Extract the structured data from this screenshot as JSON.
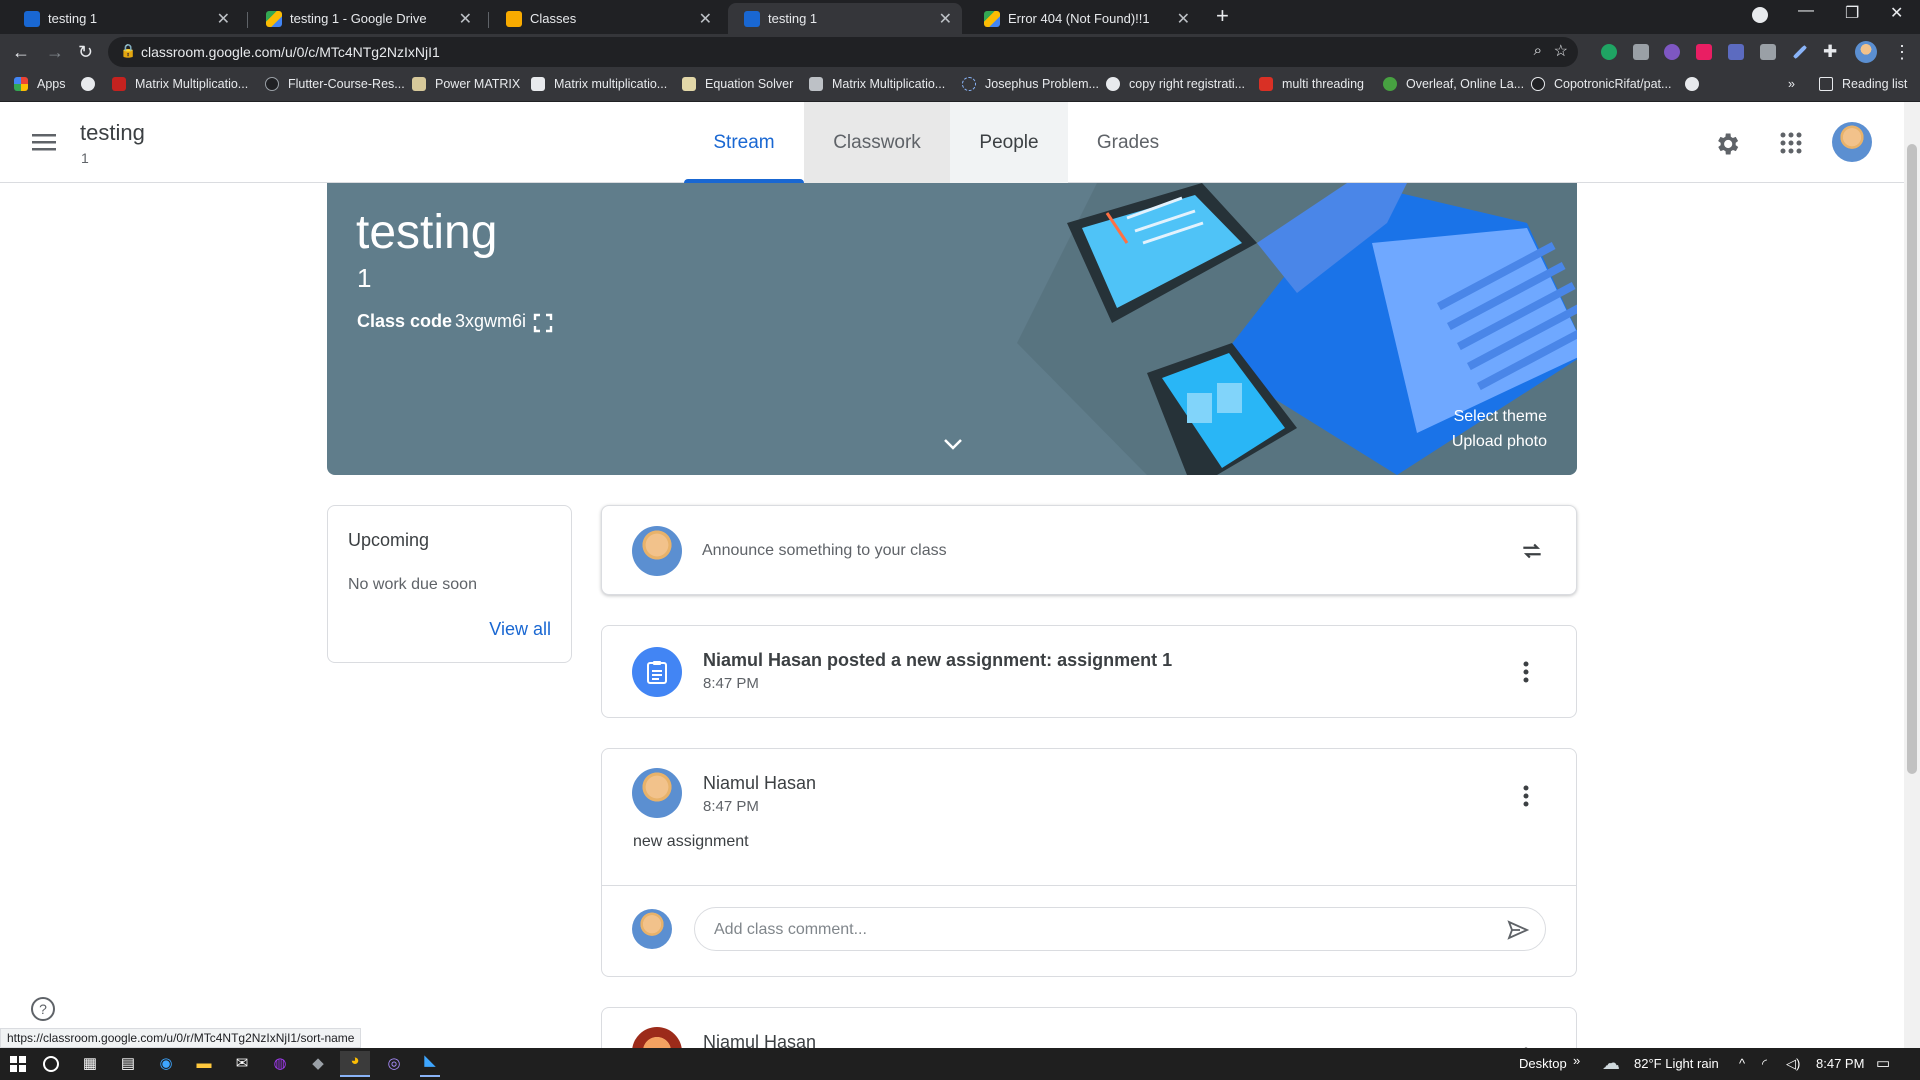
{
  "browser": {
    "tabs": [
      {
        "title": "testing 1",
        "favicon_color": "#1967d2"
      },
      {
        "title": "testing 1 - Google Drive",
        "favicon_color": "#fbbc04"
      },
      {
        "title": "Classes",
        "favicon_color": "#f9ab00"
      },
      {
        "title": "testing 1",
        "favicon_color": "#1967d2"
      },
      {
        "title": "Error 404 (Not Found)!!1",
        "favicon_color": "#34a853"
      }
    ],
    "url": "classroom.google.com/u/0/c/MTc4NTg2NzIxNjI1",
    "bookmarks": [
      "Apps",
      "Matrix Multiplicatio...",
      "Flutter-Course-Res...",
      "Power MATRIX",
      "Matrix multiplicatio...",
      "Equation Solver",
      "Matrix Multiplicatio...",
      "Josephus Problem...",
      "copy right registrati...",
      "multi threading",
      "Overleaf, Online La...",
      "CopotronicRifat/pat..."
    ],
    "reading_list": "Reading list",
    "status_url": "https://classroom.google.com/u/0/r/MTc4NTg2NzIxNjI1/sort-name"
  },
  "header": {
    "course_name": "testing",
    "course_section": "1",
    "tabs": [
      "Stream",
      "Classwork",
      "People",
      "Grades"
    ],
    "active_tab": "Stream"
  },
  "banner": {
    "title": "testing",
    "section": "1",
    "class_code_label": "Class code",
    "class_code": "3xgwm6i",
    "select_theme": "Select theme",
    "upload_photo": "Upload photo",
    "color": "#607d8b"
  },
  "upcoming": {
    "title": "Upcoming",
    "empty": "No work due soon",
    "view_all": "View all"
  },
  "announce": {
    "placeholder": "Announce something to your class"
  },
  "posts": [
    {
      "text": "Niamul Hasan posted a new assignment: assignment 1",
      "time": "8:47 PM"
    },
    {
      "author": "Niamul Hasan",
      "time": "8:47 PM",
      "body": "new assignment",
      "comment_placeholder": "Add class comment..."
    },
    {
      "author": "Niamul Hasan"
    }
  ],
  "taskbar": {
    "desktop": "Desktop",
    "weather": "82°F  Light rain",
    "time": "8:47 PM"
  },
  "colors": {
    "accent": "#1967d2",
    "assignment_icon": "#4285f4"
  }
}
